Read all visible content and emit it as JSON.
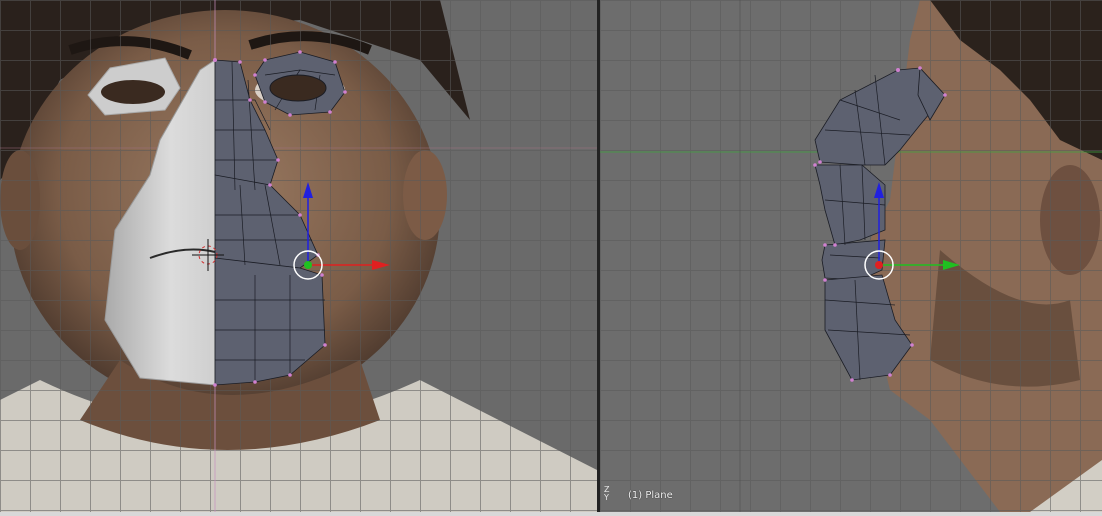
{
  "viewports": {
    "front": {
      "name": "front-view"
    },
    "side": {
      "name": "right-view"
    }
  },
  "status": {
    "object_label": "(1) Plane"
  },
  "axis_indicator": {
    "z_label": "Z",
    "y_label": "Y"
  },
  "colors": {
    "mesh_fill": "#5d6170",
    "mesh_edge": "#1a1c24",
    "vertex": "#d080d0",
    "x_axis": "#e02020",
    "y_axis": "#20c020",
    "z_axis": "#2020e0",
    "mirror_fill": "#c8c8c8"
  }
}
